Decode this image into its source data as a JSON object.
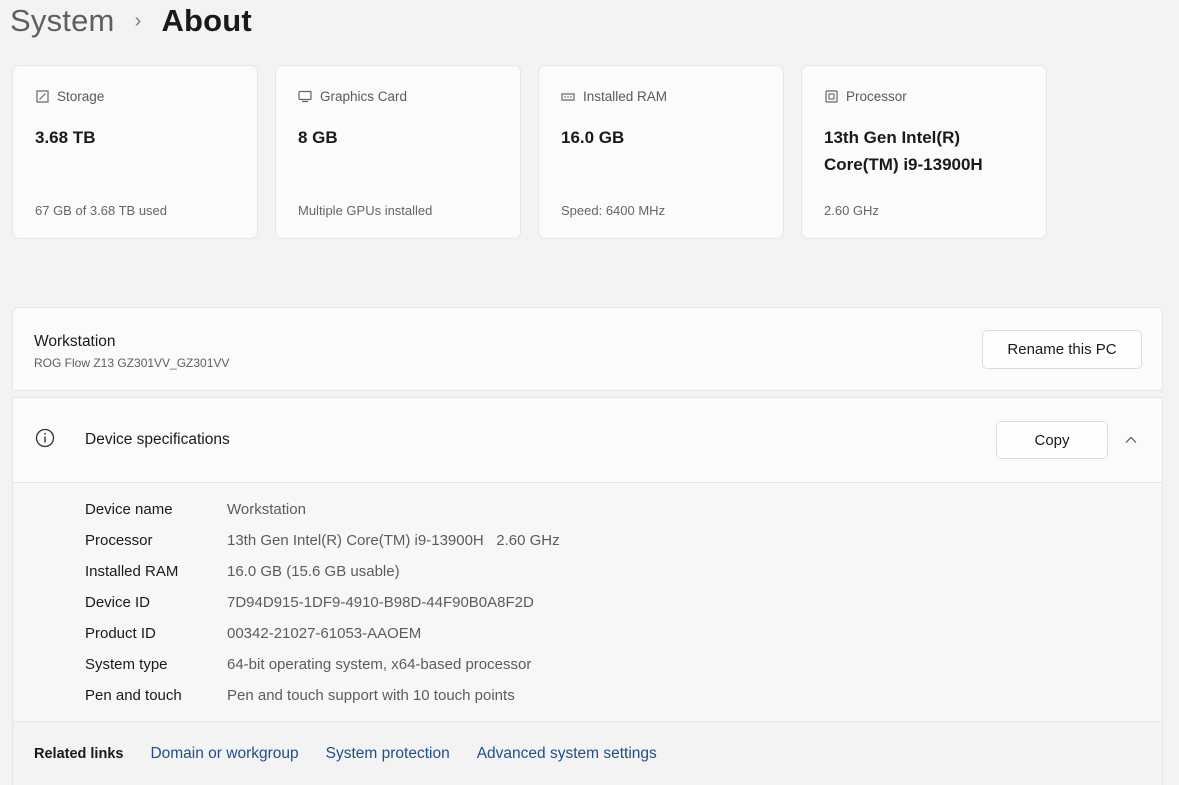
{
  "breadcrumb": {
    "parent": "System",
    "separator": "›",
    "current": "About"
  },
  "cards": [
    {
      "icon": "storage-icon",
      "label": "Storage",
      "value": "3.68 TB",
      "sub": "67 GB of 3.68 TB used"
    },
    {
      "icon": "graphics-card-icon",
      "label": "Graphics Card",
      "value": "8 GB",
      "sub": "Multiple GPUs installed"
    },
    {
      "icon": "ram-icon",
      "label": "Installed RAM",
      "value": "16.0 GB",
      "sub": "Speed: 6400 MHz"
    },
    {
      "icon": "processor-icon",
      "label": "Processor",
      "value": "13th Gen Intel(R) Core(TM) i9-13900H",
      "sub": "2.60 GHz"
    }
  ],
  "device": {
    "name": "Workstation",
    "model": "ROG Flow Z13 GZ301VV_GZ301VV",
    "rename_label": "Rename this PC"
  },
  "specs": {
    "title": "Device specifications",
    "copy_label": "Copy",
    "rows": [
      {
        "label": "Device name",
        "value": "Workstation"
      },
      {
        "label": "Processor",
        "value": "13th Gen Intel(R) Core(TM) i9-13900H   2.60 GHz"
      },
      {
        "label": "Installed RAM",
        "value": "16.0 GB (15.6 GB usable)"
      },
      {
        "label": "Device ID",
        "value": "7D94D915-1DF9-4910-B98D-44F90B0A8F2D"
      },
      {
        "label": "Product ID",
        "value": "00342-21027-61053-AAOEM"
      },
      {
        "label": "System type",
        "value": "64-bit operating system, x64-based processor"
      },
      {
        "label": "Pen and touch",
        "value": "Pen and touch support with 10 touch points"
      }
    ]
  },
  "related": {
    "label": "Related links",
    "links": [
      "Domain or workgroup",
      "System protection",
      "Advanced system settings"
    ]
  },
  "colors": {
    "link": "#1f4e8c",
    "card_bg": "#fbfbfb",
    "page_bg": "#f3f3f3"
  }
}
